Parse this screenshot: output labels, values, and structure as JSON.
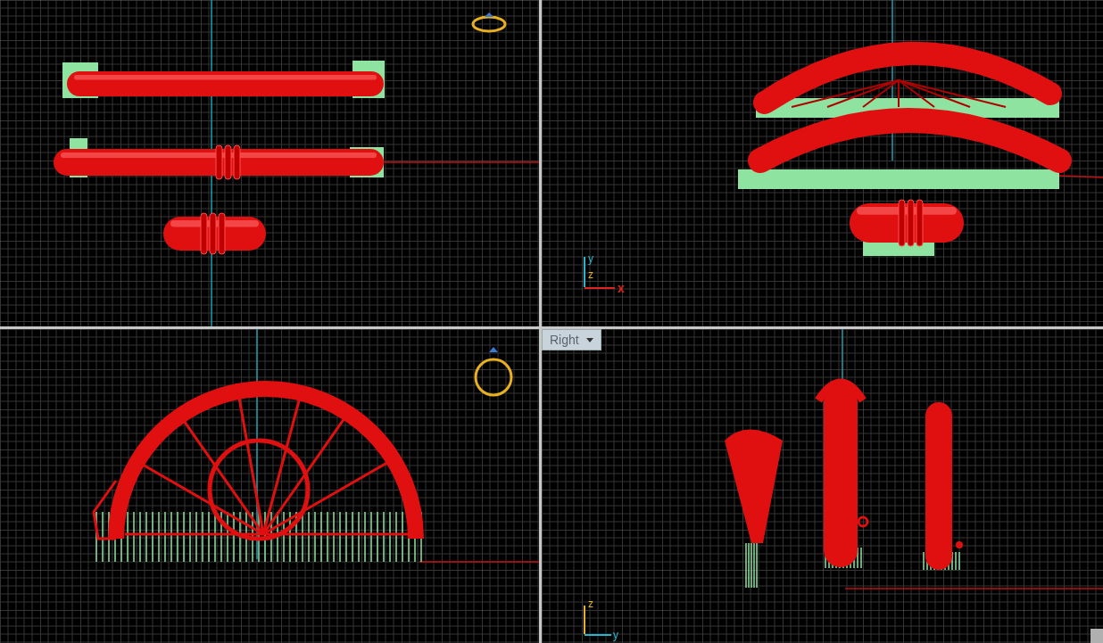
{
  "viewports": [
    {
      "kind": "top"
    },
    {
      "kind": "perspective",
      "axes": [
        {
          "axis": "y",
          "color": "#2bb5c9"
        },
        {
          "axis": "z",
          "color": "#e3b22a"
        },
        {
          "axis": "x",
          "color": "#e02222"
        }
      ]
    },
    {
      "kind": "front"
    },
    {
      "kind": "right",
      "label": "Right",
      "axes": [
        {
          "axis": "z",
          "color": "#e3b22a"
        },
        {
          "axis": "y",
          "color": "#2bb5c9"
        }
      ]
    }
  ]
}
